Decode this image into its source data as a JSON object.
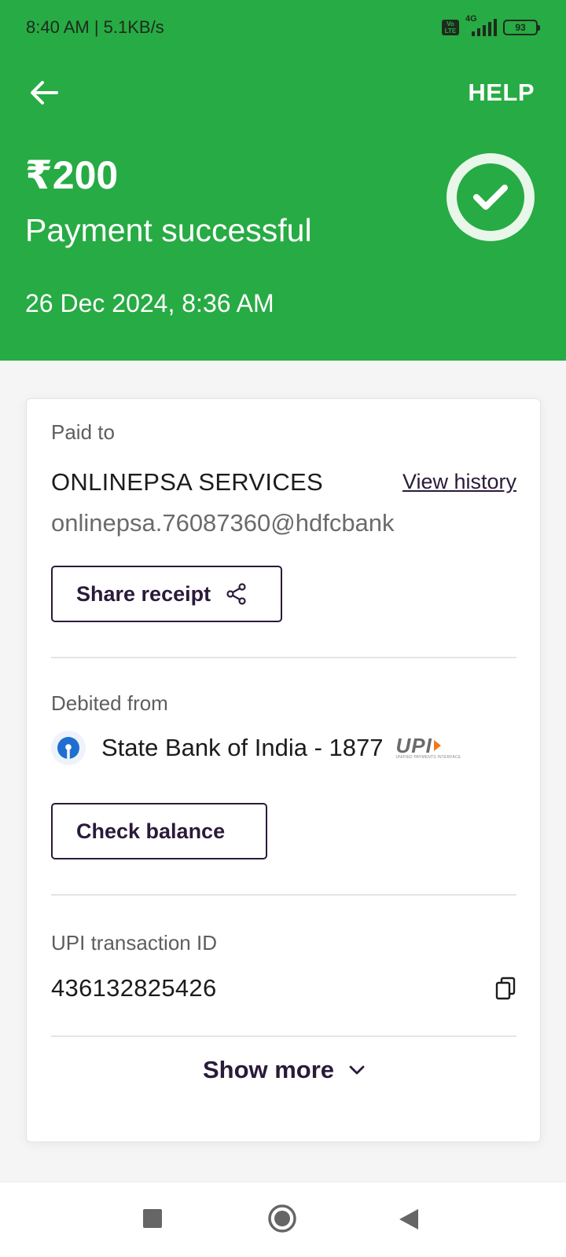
{
  "status_bar": {
    "time": "8:40 AM | 5.1KB/s",
    "network": "4G",
    "volte": "Vo LTE",
    "battery": "93"
  },
  "header": {
    "help_label": "HELP",
    "amount": "₹200",
    "status": "Payment successful",
    "datetime": "26 Dec 2024, 8:36 AM",
    "accent_color": "#27ab44"
  },
  "paid_to": {
    "label": "Paid to",
    "name": "ONLINEPSA SERVICES",
    "view_history_label": "View history",
    "upi_id": "onlinepsa.76087360@hdfcbank",
    "share_label": "Share receipt"
  },
  "debited_from": {
    "label": "Debited from",
    "bank": "State Bank of India - 1877",
    "upi_brand": "UPI",
    "upi_tagline": "UNIFIED PAYMENTS INTERFACE",
    "check_balance_label": "Check balance"
  },
  "transaction": {
    "label": "UPI transaction ID",
    "id": "436132825426"
  },
  "show_more_label": "Show more",
  "icons": {
    "back": "arrow-left-icon",
    "success": "check-circle-icon",
    "share": "share-icon",
    "bank": "sbi-logo-icon",
    "copy": "copy-icon",
    "expand": "chevron-down-icon"
  }
}
